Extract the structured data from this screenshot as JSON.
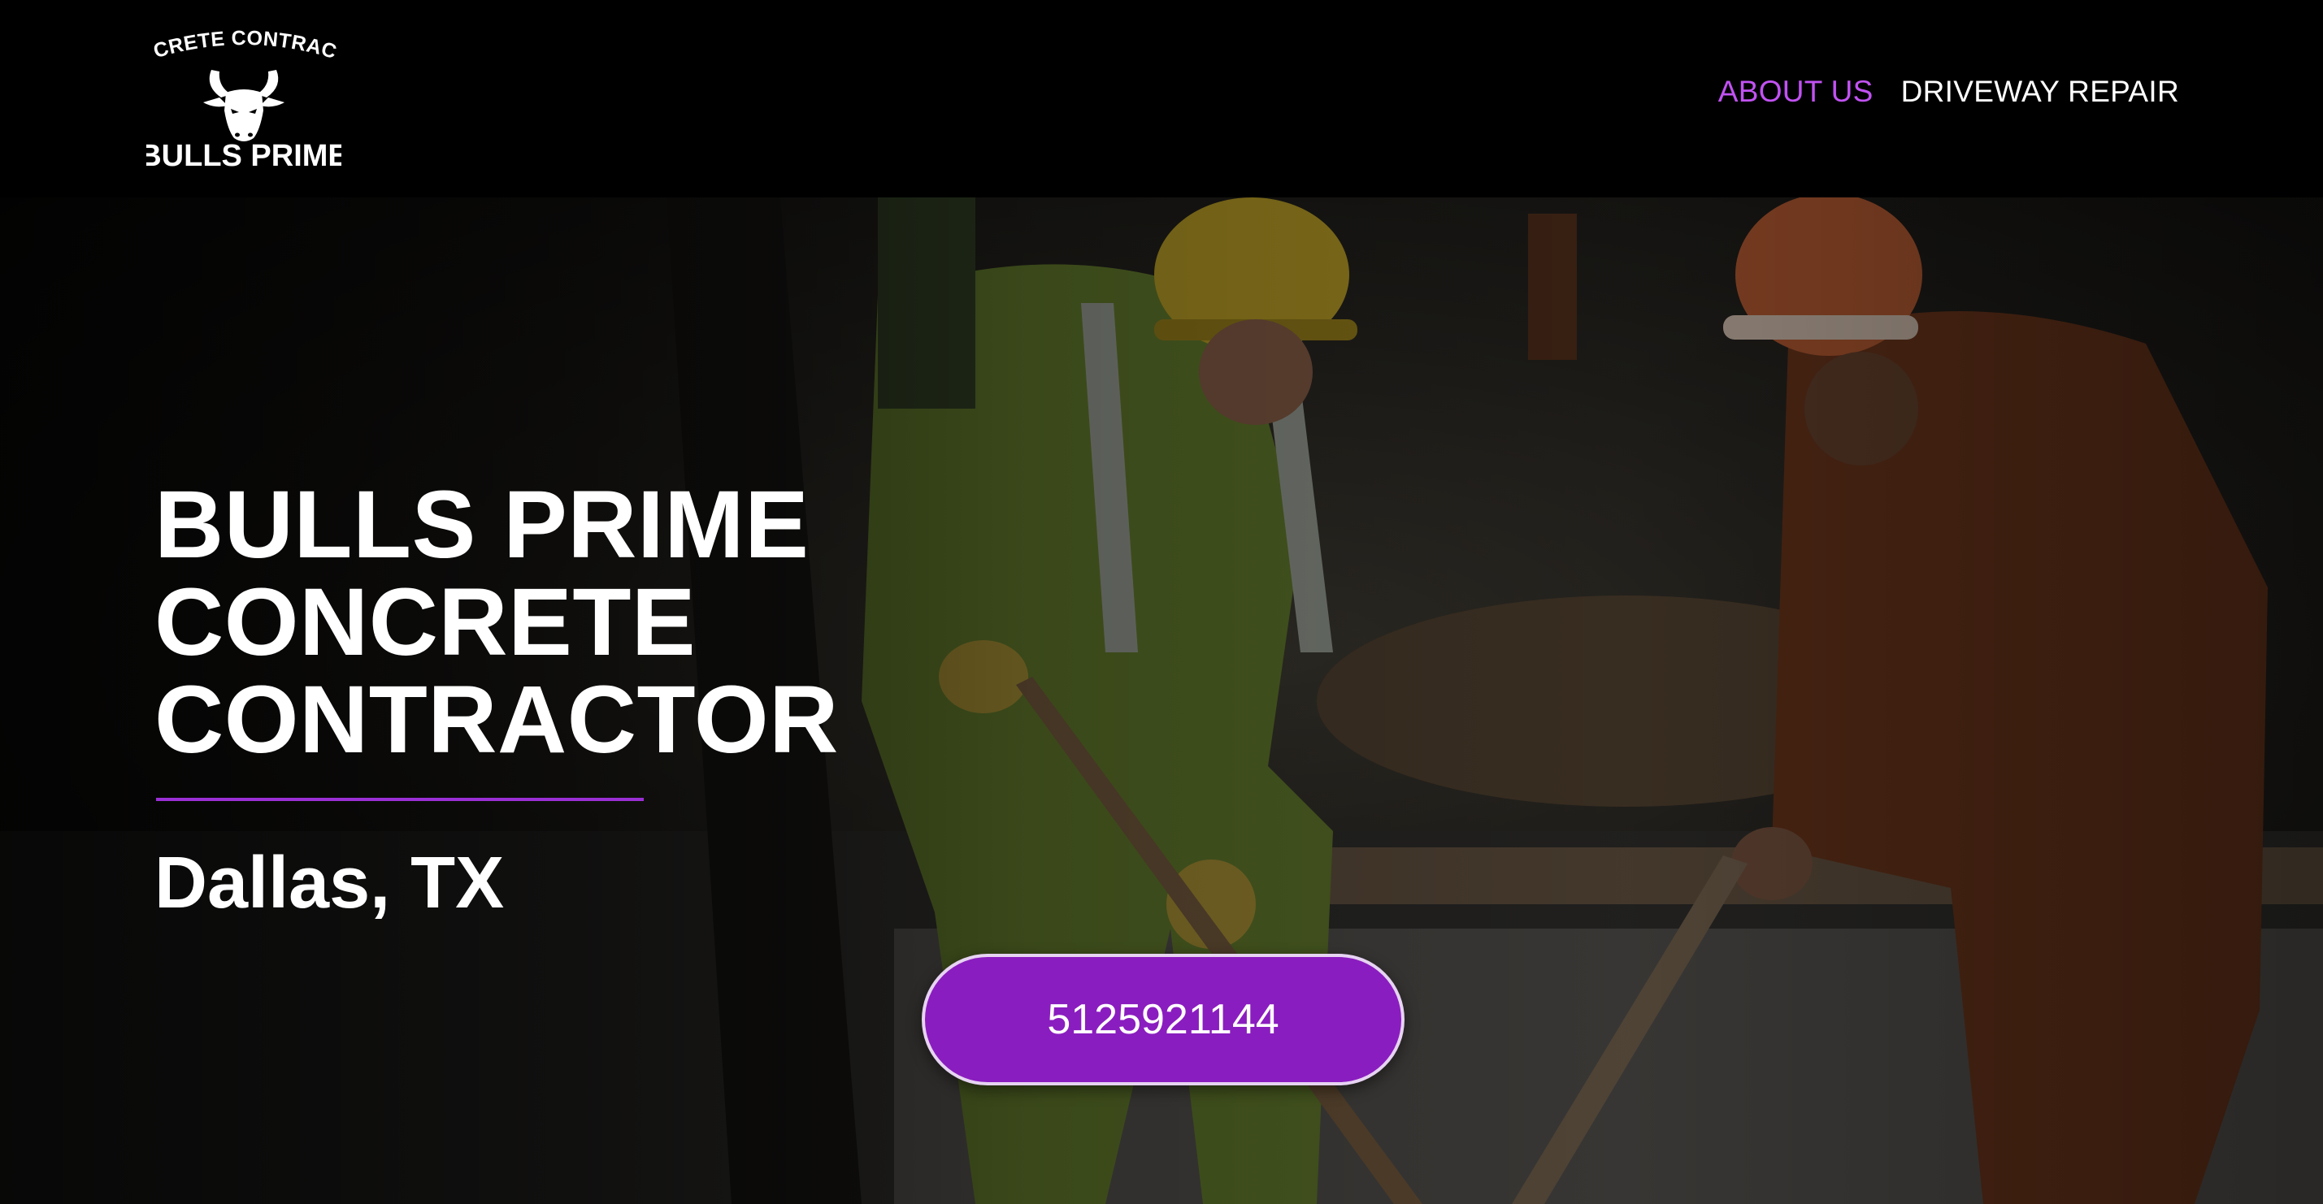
{
  "brand": {
    "tagline": "CONCRETE CONTRACTOR",
    "name": "BULLS PRIME"
  },
  "nav": {
    "items": [
      {
        "label": "ABOUT US",
        "active": true
      },
      {
        "label": "DRIVEWAY REPAIR",
        "active": false
      }
    ],
    "active_color": "#c152f2"
  },
  "hero": {
    "title_lines": [
      "BULLS PRIME",
      "CONCRETE",
      "CONTRACTOR"
    ],
    "location": "Dallas, TX",
    "cta_label": "5125921144",
    "accent_color": "#8a1dbf"
  },
  "icons": {
    "logo": "bull-head-icon"
  }
}
